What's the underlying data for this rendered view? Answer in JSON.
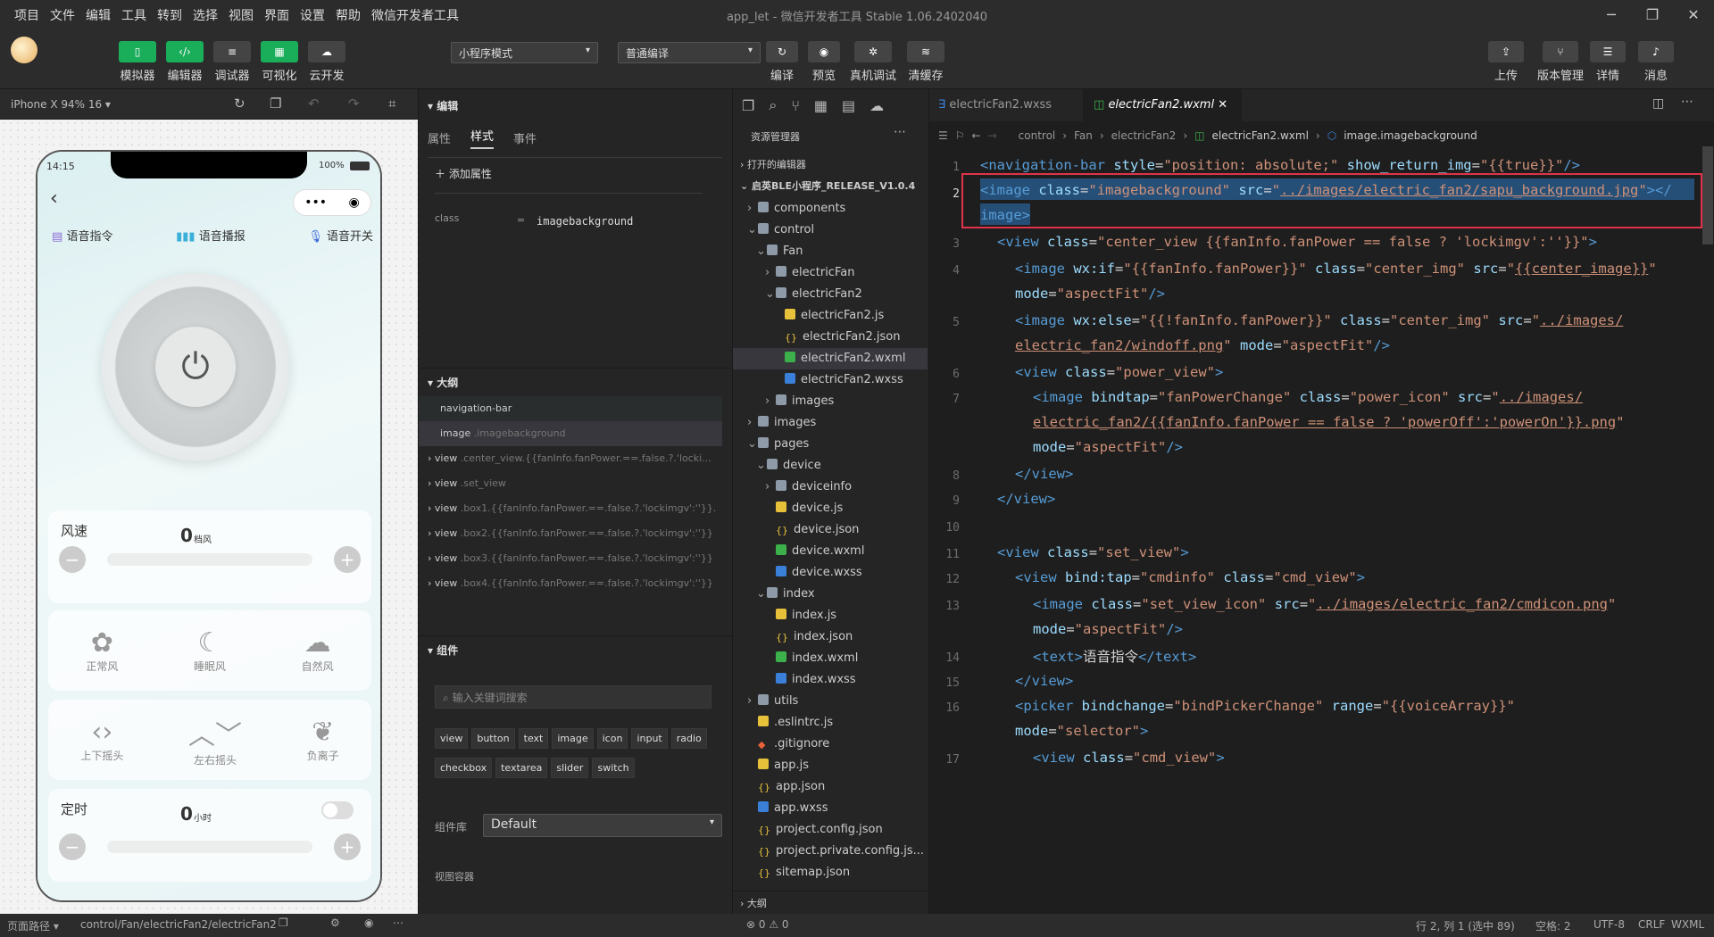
{
  "titlebar": {
    "menu": [
      "项目",
      "文件",
      "编辑",
      "工具",
      "转到",
      "选择",
      "视图",
      "界面",
      "设置",
      "帮助",
      "微信开发者工具"
    ],
    "title": "app_let - 微信开发者工具 Stable 1.06.2402040"
  },
  "toolbar": {
    "left_buttons": [
      "模拟器",
      "编辑器",
      "调试器",
      "可视化",
      "云开发"
    ],
    "mode_select": "小程序模式",
    "compile_select": "普通编译",
    "mid_buttons": [
      "编译",
      "预览",
      "真机调试",
      "清缓存"
    ],
    "right_buttons": [
      "上传",
      "版本管理",
      "详情",
      "消息"
    ]
  },
  "simulator": {
    "device": "iPhone X 94% 16 ▾",
    "time": "14:15",
    "battery": "100%",
    "voice_items": [
      "语音指令",
      "语音播报",
      "语音开关"
    ],
    "speed_label": "风速",
    "speed_value": "0",
    "speed_unit": "档风",
    "modes1": [
      "正常风",
      "睡眠风",
      "自然风"
    ],
    "modes2": [
      "上下摇头",
      "左右摇头",
      "负离子"
    ],
    "timer_label": "定时",
    "timer_value": "0",
    "timer_unit": "小时",
    "minus": "−",
    "plus": "+"
  },
  "inspector": {
    "header": "编辑",
    "tabs": [
      "属性",
      "样式",
      "事件"
    ],
    "add_attr": "添加属性",
    "attr_name": "class",
    "attr_eq": "=",
    "attr_value": "imagebackground",
    "outline_header": "大纲",
    "outline": [
      {
        "tag": "navigation-bar",
        "cls": ""
      },
      {
        "tag": "image",
        "cls": ".imagebackground"
      },
      {
        "tag": "view",
        "cls": ".center_view.{{fanInfo.fanPower.==.false.?.'locki..."
      },
      {
        "tag": "view",
        "cls": ".set_view"
      },
      {
        "tag": "view",
        "cls": ".box1.{{fanInfo.fanPower.==.false.?.'lockimgv':''}}."
      },
      {
        "tag": "view",
        "cls": ".box2.{{fanInfo.fanPower.==.false.?.'lockimgv':''}}"
      },
      {
        "tag": "view",
        "cls": ".box3.{{fanInfo.fanPower.==.false.?.'lockimgv':''}}"
      },
      {
        "tag": "view",
        "cls": ".box4.{{fanInfo.fanPower.==.false.?.'lockimgv':''}}"
      }
    ],
    "components_header": "组件",
    "search_placeholder": "输入关键词搜索",
    "chips": [
      "view",
      "button",
      "text",
      "image",
      "icon",
      "input",
      "radio",
      "checkbox",
      "textarea",
      "slider",
      "switch"
    ],
    "lib_label": "组件库",
    "lib_value": "Default",
    "container_label": "视图容器"
  },
  "explorer": {
    "header": "资源管理器",
    "open_editors": "打开的编辑器",
    "project": "启英BLE小程序_RELEASE_V1.0.4",
    "outline": "大纲",
    "problems": "⊗ 0 ⚠ 0",
    "tree": [
      {
        "name": "components",
        "indent": 1,
        "type": "folder",
        "arrow": "›"
      },
      {
        "name": "control",
        "indent": 1,
        "type": "folder",
        "arrow": "⌄"
      },
      {
        "name": "Fan",
        "indent": 2,
        "type": "folder",
        "arrow": "⌄"
      },
      {
        "name": "electricFan",
        "indent": 3,
        "type": "folder",
        "arrow": "›"
      },
      {
        "name": "electricFan2",
        "indent": 3,
        "type": "folder",
        "arrow": "⌄"
      },
      {
        "name": "electricFan2.js",
        "indent": 4,
        "type": "js",
        "arrow": ""
      },
      {
        "name": "electricFan2.json",
        "indent": 4,
        "type": "json",
        "arrow": ""
      },
      {
        "name": "electricFan2.wxml",
        "indent": 4,
        "type": "wxml",
        "arrow": "",
        "active": true
      },
      {
        "name": "electricFan2.wxss",
        "indent": 4,
        "type": "wxss",
        "arrow": ""
      },
      {
        "name": "images",
        "indent": 3,
        "type": "folder",
        "arrow": "›"
      },
      {
        "name": "images",
        "indent": 1,
        "type": "folder",
        "arrow": "›"
      },
      {
        "name": "pages",
        "indent": 1,
        "type": "folder",
        "arrow": "⌄"
      },
      {
        "name": "device",
        "indent": 2,
        "type": "folder",
        "arrow": "⌄"
      },
      {
        "name": "deviceinfo",
        "indent": 3,
        "type": "folder",
        "arrow": "›"
      },
      {
        "name": "device.js",
        "indent": 3,
        "type": "js",
        "arrow": ""
      },
      {
        "name": "device.json",
        "indent": 3,
        "type": "json",
        "arrow": ""
      },
      {
        "name": "device.wxml",
        "indent": 3,
        "type": "wxml",
        "arrow": ""
      },
      {
        "name": "device.wxss",
        "indent": 3,
        "type": "wxss",
        "arrow": ""
      },
      {
        "name": "index",
        "indent": 2,
        "type": "folder",
        "arrow": "⌄"
      },
      {
        "name": "index.js",
        "indent": 3,
        "type": "js",
        "arrow": ""
      },
      {
        "name": "index.json",
        "indent": 3,
        "type": "json",
        "arrow": ""
      },
      {
        "name": "index.wxml",
        "indent": 3,
        "type": "wxml",
        "arrow": ""
      },
      {
        "name": "index.wxss",
        "indent": 3,
        "type": "wxss",
        "arrow": ""
      },
      {
        "name": "utils",
        "indent": 1,
        "type": "folder",
        "arrow": "›"
      },
      {
        "name": ".eslintrc.js",
        "indent": 1,
        "type": "js",
        "arrow": ""
      },
      {
        "name": ".gitignore",
        "indent": 1,
        "type": "git",
        "arrow": ""
      },
      {
        "name": "app.js",
        "indent": 1,
        "type": "js",
        "arrow": ""
      },
      {
        "name": "app.json",
        "indent": 1,
        "type": "json",
        "arrow": ""
      },
      {
        "name": "app.wxss",
        "indent": 1,
        "type": "wxss",
        "arrow": ""
      },
      {
        "name": "project.config.json",
        "indent": 1,
        "type": "json",
        "arrow": ""
      },
      {
        "name": "project.private.config.js...",
        "indent": 1,
        "type": "json",
        "arrow": ""
      },
      {
        "name": "sitemap.json",
        "indent": 1,
        "type": "json",
        "arrow": ""
      }
    ]
  },
  "editor": {
    "tabs": [
      "electricFan2.wxss",
      "electricFan2.wxml"
    ],
    "breadcrumb": [
      "control",
      "Fan",
      "electricFan2",
      "electricFan2.wxml",
      "image.imagebackground"
    ]
  },
  "status": {
    "path_label": "页面路径 ▾",
    "path": "control/Fan/electricFan2/electricFan2",
    "position": "行 2, 列 1 (选中 89)",
    "spaces": "空格: 2",
    "encoding": "UTF-8",
    "eol": "CRLF",
    "lang": "WXML"
  }
}
